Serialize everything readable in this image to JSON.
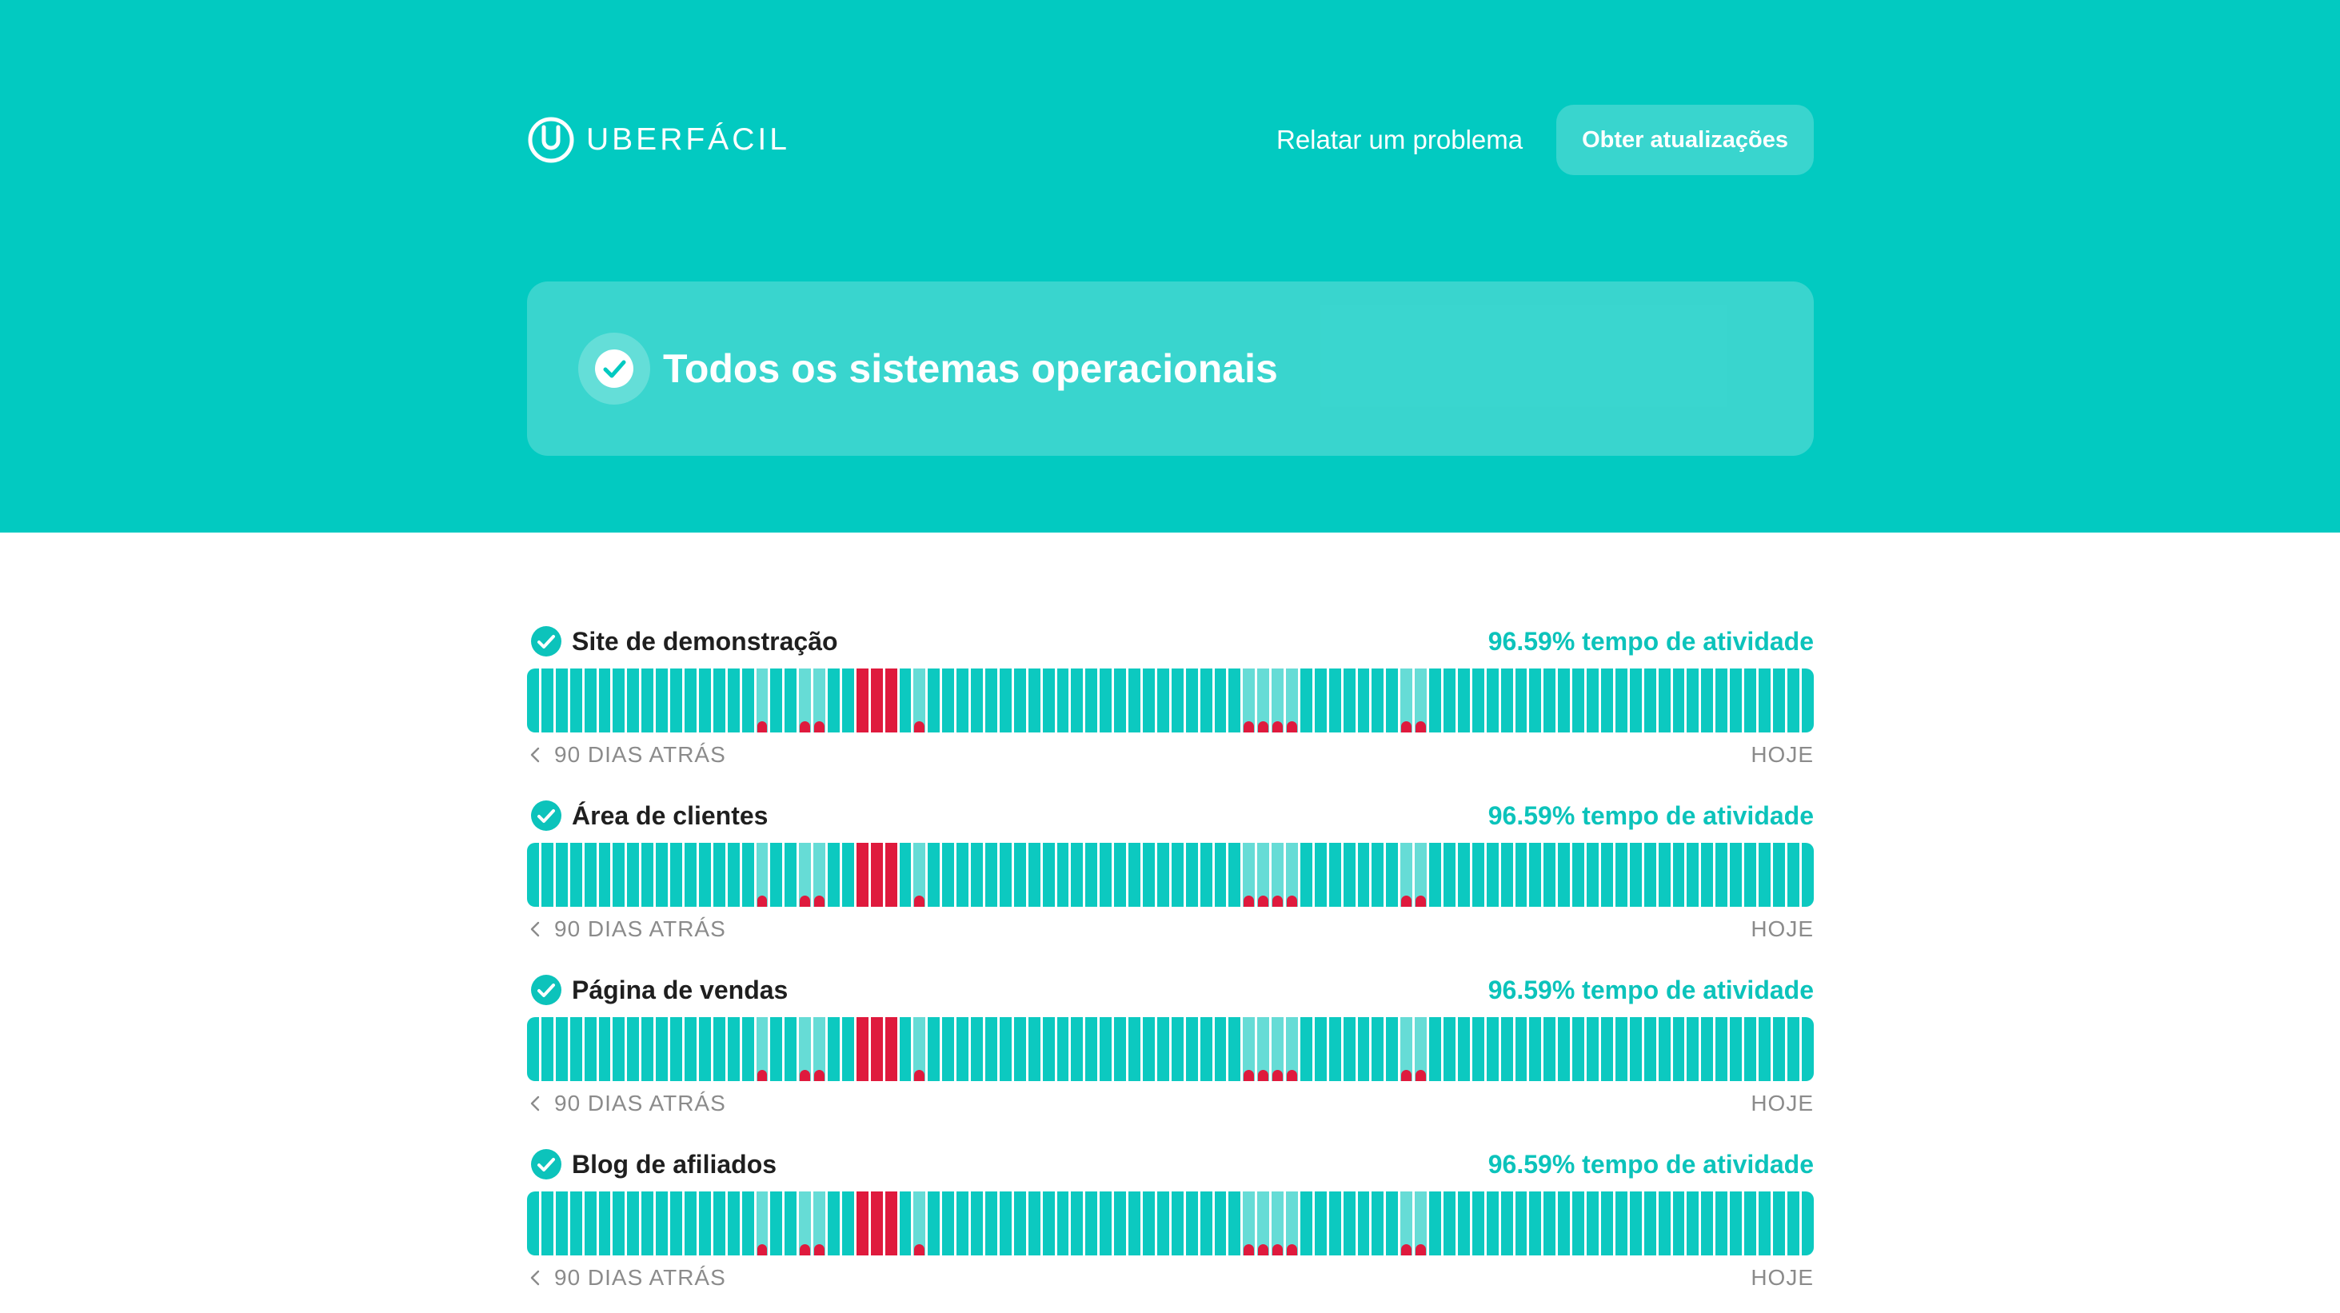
{
  "brand": {
    "name": "UBERFÁCIL",
    "color": "#02cac1"
  },
  "header": {
    "report_link": "Relatar um problema",
    "updates_button": "Obter atualizações"
  },
  "banner": {
    "status": "Todos os sistemas operacionais",
    "icon": "check-circle-icon"
  },
  "legend": {
    "start": "90 DIAS ATRÁS",
    "end": "HOJE"
  },
  "status_colors": {
    "operational": "#0cc9c0",
    "degraded": "#66dcd6",
    "outage": "#df1a3d"
  },
  "day_pattern": {
    "days": 90,
    "states": [
      "up",
      "up",
      "up",
      "up",
      "up",
      "up",
      "up",
      "up",
      "up",
      "up",
      "up",
      "up",
      "up",
      "up",
      "up",
      "up",
      "minor",
      "up",
      "up",
      "minor",
      "minor",
      "up",
      "up",
      "major",
      "major",
      "major",
      "up",
      "minor",
      "up",
      "up",
      "up",
      "up",
      "up",
      "up",
      "up",
      "up",
      "up",
      "up",
      "up",
      "up",
      "up",
      "up",
      "up",
      "up",
      "up",
      "up",
      "up",
      "up",
      "up",
      "up",
      "minor",
      "minor",
      "minor",
      "minor",
      "up",
      "up",
      "up",
      "up",
      "up",
      "up",
      "up",
      "minor",
      "minor",
      "up",
      "up",
      "up",
      "up",
      "up",
      "up",
      "up",
      "up",
      "up",
      "up",
      "up",
      "up",
      "up",
      "up",
      "up",
      "up",
      "up",
      "up",
      "up",
      "up",
      "up",
      "up",
      "up",
      "up",
      "up",
      "up",
      "up"
    ]
  },
  "components": [
    {
      "name": "Site de demonstração",
      "uptime": "96.59% tempo de atividade"
    },
    {
      "name": "Área de clientes",
      "uptime": "96.59% tempo de atividade"
    },
    {
      "name": "Página de vendas",
      "uptime": "96.59% tempo de atividade"
    },
    {
      "name": "Blog de afiliados",
      "uptime": "96.59% tempo de atividade"
    }
  ]
}
